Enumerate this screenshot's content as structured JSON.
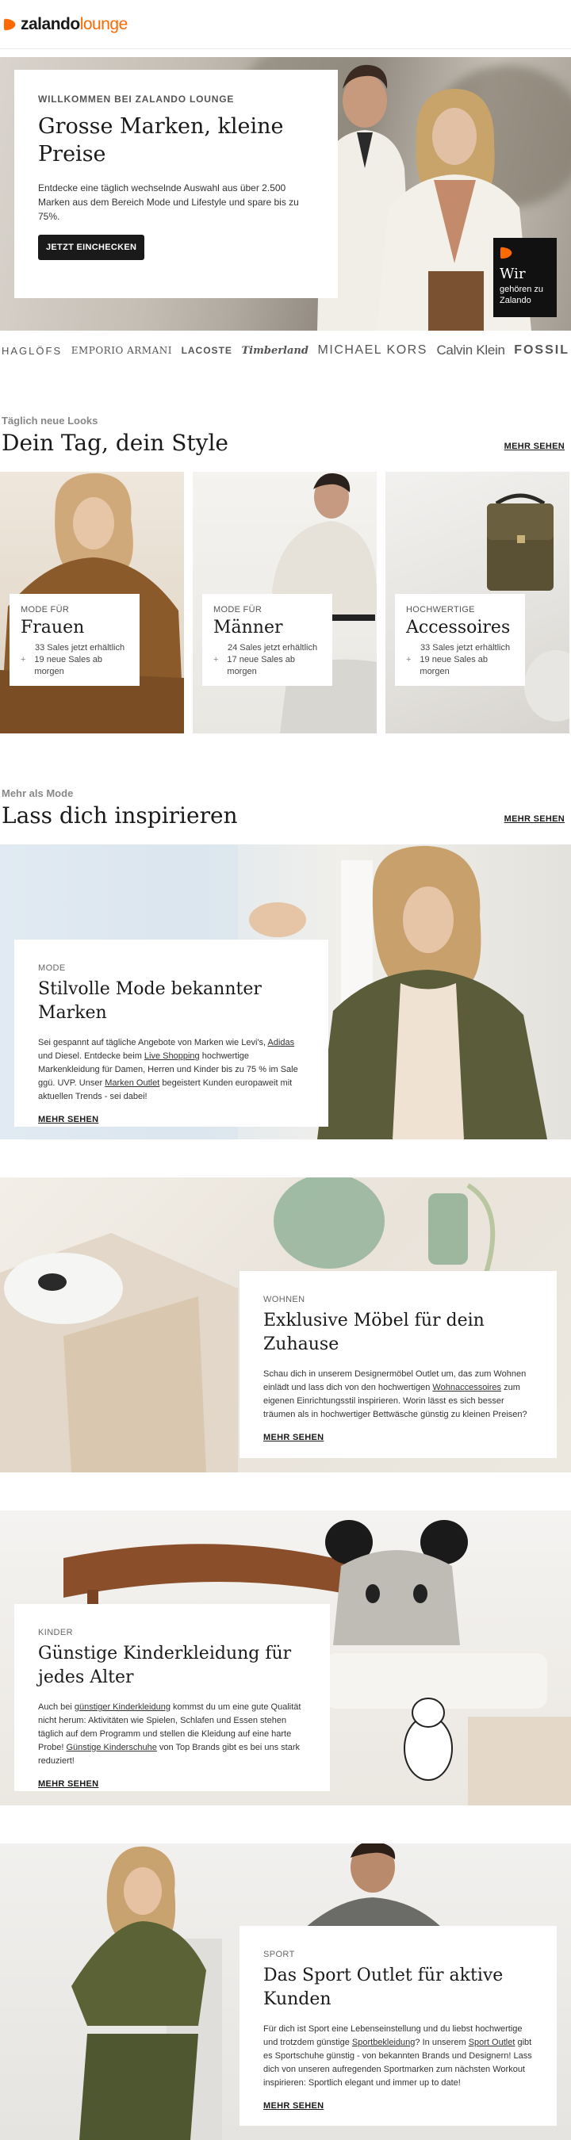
{
  "header": {
    "logo_primary": "zalando",
    "logo_secondary": "lounge",
    "brand_color": "#ff6900"
  },
  "hero": {
    "eyebrow": "WILLKOMMEN BEI ZALANDO LOUNGE",
    "title": "Grosse Marken, kleine Preise",
    "text": "Entdecke eine täglich wechselnde Auswahl aus über 2.500 Marken aus dem Bereich Mode und Lifestyle und spare bis zu 75%.",
    "cta": "JETZT EINCHECKEN",
    "badge_title": "Wir",
    "badge_text": "gehören zu Zalando"
  },
  "brands": [
    "HAGLÖFS",
    "EMPORIO ARMANI",
    "LACOSTE",
    "Timberland",
    "MICHAEL KORS",
    "Calvin Klein",
    "FOSSIL"
  ],
  "looks": {
    "eyebrow": "Täglich neue Looks",
    "title": "Dein Tag, dein Style",
    "more": "MEHR SEHEN",
    "categories": [
      {
        "eyebrow": "MODE FÜR",
        "title": "Frauen",
        "count": "33 Sales jetzt erhältlich",
        "upcoming": "19 neue Sales ab morgen"
      },
      {
        "eyebrow": "MODE FÜR",
        "title": "Männer",
        "count": "24 Sales jetzt erhältlich",
        "upcoming": "17 neue Sales ab morgen"
      },
      {
        "eyebrow": "HOCHWERTIGE",
        "title": "Accessoires",
        "count": "33 Sales jetzt erhältlich",
        "upcoming": "19 neue Sales ab morgen"
      }
    ]
  },
  "inspire": {
    "eyebrow": "Mehr als Mode",
    "title": "Lass dich inspirieren",
    "more": "MEHR SEHEN"
  },
  "features": [
    {
      "eyebrow": "MODE",
      "title": "Stilvolle Mode bekannter Marken",
      "text_parts": [
        "Sei gespannt auf tägliche Angebote von Marken wie Levi's, ",
        "Adidas",
        " und Diesel. Entdecke beim ",
        "Live Shopping",
        " hochwertige Markenkleidung für Damen, Herren und Kinder bis zu 75 % im Sale ggü. UVP. Unser ",
        "Marken Outlet",
        " begeistert Kunden europaweit mit aktuellen Trends - sei dabei!"
      ],
      "link": "MEHR SEHEN"
    },
    {
      "eyebrow": "WOHNEN",
      "title": "Exklusive Möbel für dein Zuhause",
      "text_parts": [
        "Schau dich in unserem Designermöbel Outlet um, das zum Wohnen einlädt und lass dich von den hochwertigen ",
        "Wohnaccessoires",
        " zum eigenen Einrichtungsstil inspirieren. Worin lässt es sich besser träumen als in hochwertiger Bettwäsche günstig zu kleinen Preisen?"
      ],
      "link": "MEHR SEHEN"
    },
    {
      "eyebrow": "KINDER",
      "title": "Günstige Kinderkleidung für jedes Alter",
      "text_parts": [
        "Auch bei ",
        "günstiger Kinderkleidung",
        " kommst du um eine gute Qualität nicht herum: Aktivitäten wie Spielen, Schlafen und Essen stehen täglich auf dem Programm und stellen die Kleidung auf eine harte Probe! ",
        "Günstige Kinderschuhe",
        " von Top Brands gibt es bei uns stark reduziert!"
      ],
      "link": "MEHR SEHEN"
    },
    {
      "eyebrow": "SPORT",
      "title": "Das Sport Outlet für aktive Kunden",
      "text_parts": [
        "Für dich ist Sport eine Lebenseinstellung und du liebst hochwertige und trotzdem günstige ",
        "Sportbekleidung",
        "? In unserem ",
        "Sport Outlet",
        " gibt es Sportschuhe günstig - von bekannten Brands und Designern! Lass dich von unseren aufregenden Sportmarken zum nächsten Workout inspirieren: Sportlich elegant und immer up to date!"
      ],
      "link": "MEHR SEHEN"
    }
  ]
}
